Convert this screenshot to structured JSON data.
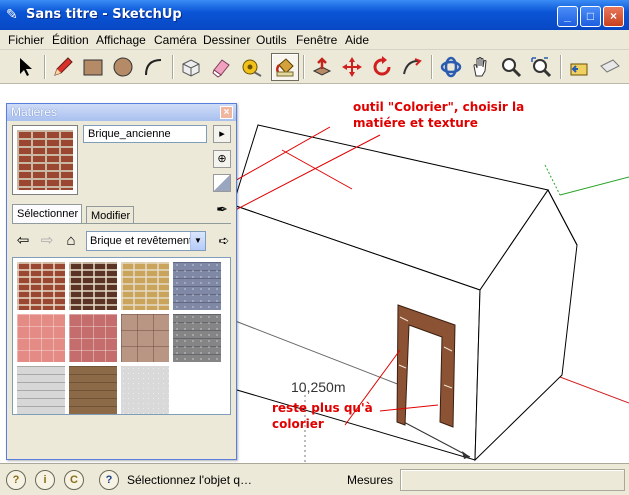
{
  "window": {
    "title": "Sans titre - SketchUp",
    "controls": {
      "minimize": "_",
      "maximize": "□",
      "close": "×"
    }
  },
  "menu": [
    "Fichier",
    "Édition",
    "Affichage",
    "Caméra",
    "Dessiner",
    "Outils",
    "Fenêtre",
    "Aide"
  ],
  "toolbar": {
    "tools": [
      {
        "icon": "select-arrow-icon"
      },
      {
        "icon": "pencil-line-icon"
      },
      {
        "icon": "rectangle-icon"
      },
      {
        "icon": "circle-icon"
      },
      {
        "icon": "arc-icon"
      },
      {
        "icon": "make-component-icon"
      },
      {
        "icon": "eraser-icon"
      },
      {
        "icon": "tape-measure-icon"
      },
      {
        "icon": "paint-bucket-icon",
        "active": true
      },
      {
        "icon": "push-pull-icon"
      },
      {
        "icon": "move-icon"
      },
      {
        "icon": "rotate-icon"
      },
      {
        "icon": "follow-me-icon"
      },
      {
        "icon": "orbit-icon"
      },
      {
        "icon": "pan-icon"
      },
      {
        "icon": "zoom-icon"
      },
      {
        "icon": "zoom-extents-icon"
      },
      {
        "icon": "previous-view-icon"
      },
      {
        "icon": "next-view-icon"
      }
    ]
  },
  "annotations": {
    "paint_tool_note": [
      "outil \"Colorier\", choisir la",
      "matiére et texture"
    ],
    "colorize_note": [
      "reste plus qu'à",
      "colorier"
    ],
    "dimension": "10,250m",
    "color": "#e00000"
  },
  "materials_panel": {
    "title": "Matières",
    "close": "×",
    "material_name": "Brique_ancienne",
    "tabs": [
      "Sélectionner",
      "Modifier"
    ],
    "active_tab": "Sélectionner",
    "library": "Brique et revêtement",
    "swatches": [
      {
        "name": "brick-old",
        "color": "#9b4630",
        "pattern": "brick"
      },
      {
        "name": "brick-dark",
        "color": "#5a3324",
        "pattern": "brick"
      },
      {
        "name": "brick-yellow",
        "color": "#c9a45a",
        "pattern": "brick"
      },
      {
        "name": "stone-blue",
        "color": "#7f89a6",
        "pattern": "stone"
      },
      {
        "name": "tile-pink",
        "color": "#e58b85",
        "pattern": "tile"
      },
      {
        "name": "tile-rose",
        "color": "#c56d6d",
        "pattern": "tile"
      },
      {
        "name": "stone-tan",
        "color": "#b99583",
        "pattern": "flag"
      },
      {
        "name": "slate-gray",
        "color": "#858585",
        "pattern": "stone"
      },
      {
        "name": "siding-white",
        "color": "#d7d7d7",
        "pattern": "siding"
      },
      {
        "name": "siding-wood",
        "color": "#8c6a48",
        "pattern": "siding"
      },
      {
        "name": "stucco-white",
        "color": "#d9d9d9",
        "pattern": "plain"
      }
    ]
  },
  "statusbar": {
    "hint": "Sélectionnez l'objet q…",
    "measure_label": "Mesures",
    "measure_value": ""
  }
}
